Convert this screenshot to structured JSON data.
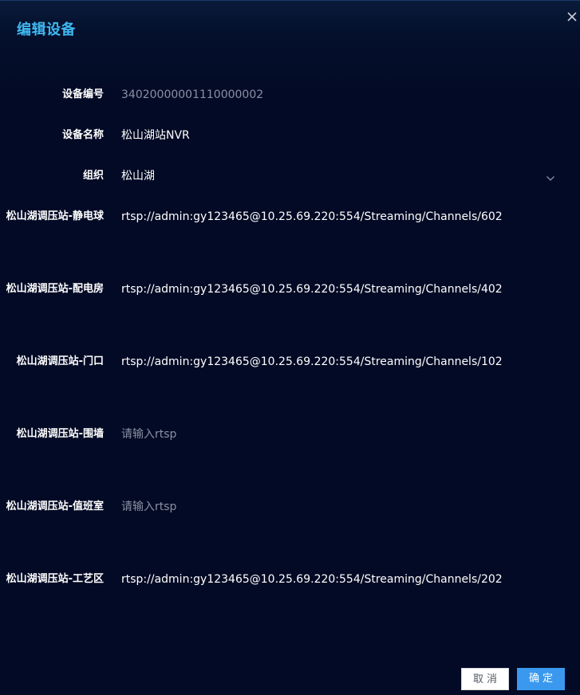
{
  "dialog": {
    "title": "编辑设备",
    "cancel_label": "取消",
    "ok_label": "确定"
  },
  "fields": {
    "device_no": {
      "label": "设备编号",
      "value": "34020000001110000002"
    },
    "device_name": {
      "label": "设备名称",
      "value": "松山湖站NVR"
    },
    "org": {
      "label": "组织",
      "value": "松山湖"
    },
    "ch1": {
      "label": "松山湖调压站-静电球",
      "value": "rtsp://admin:gy123465@10.25.69.220:554/Streaming/Channels/602"
    },
    "ch2": {
      "label": "松山湖调压站-配电房",
      "value": "rtsp://admin:gy123465@10.25.69.220:554/Streaming/Channels/402"
    },
    "ch3": {
      "label": "松山湖调压站-门口",
      "value": "rtsp://admin:gy123465@10.25.69.220:554/Streaming/Channels/102"
    },
    "ch4": {
      "label": "松山湖调压站-围墙",
      "placeholder": "请输入rtsp"
    },
    "ch5": {
      "label": "松山湖调压站-值班室",
      "placeholder": "请输入rtsp"
    },
    "ch6": {
      "label": "松山湖调压站-工艺区",
      "value": "rtsp://admin:gy123465@10.25.69.220:554/Streaming/Channels/202"
    }
  },
  "colors": {
    "background": "#030a25",
    "title": "#3fb8f0",
    "primary_button": "#3a99ee"
  },
  "icons": {
    "close": "close-icon",
    "select": "chevron-down-icon"
  }
}
